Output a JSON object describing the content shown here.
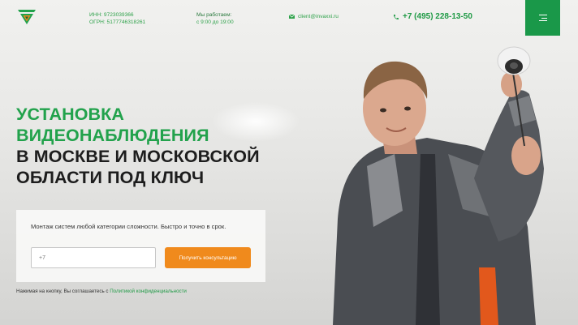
{
  "header": {
    "inn": "ИНН: 9723039366",
    "ogrn": "ОГРН: 5177746318261",
    "hours_label": "Мы работаем:",
    "hours_value": "с 9:00 до 19:00",
    "email": "client@invaxxi.ru",
    "phone": "+7 (495) 228-13-50"
  },
  "hero": {
    "title_line1": "УСТАНОВКА",
    "title_line2": "ВИДЕОНАБЛЮДЕНИЯ",
    "title_line3": "В МОСКВЕ И МОСКОВСКОЙ",
    "title_line4": "ОБЛАСТИ ПОД КЛЮЧ"
  },
  "form": {
    "description": "Монтаж систем любой категории сложности. Быстро и точно в срок.",
    "phone_placeholder": "+7",
    "submit_label": "Получить консультацию",
    "consent_text": "Нажимая на кнопку, Вы соглашаетесь с ",
    "consent_link": "Политикой конфиденциальности"
  },
  "colors": {
    "brand_green": "#22a24c",
    "menu_green": "#1a9849",
    "cta_orange": "#f08a1c"
  },
  "icons": {
    "logo": "v-logo-icon",
    "email": "envelope-icon",
    "phone": "phone-icon",
    "menu": "hamburger-menu-icon"
  }
}
